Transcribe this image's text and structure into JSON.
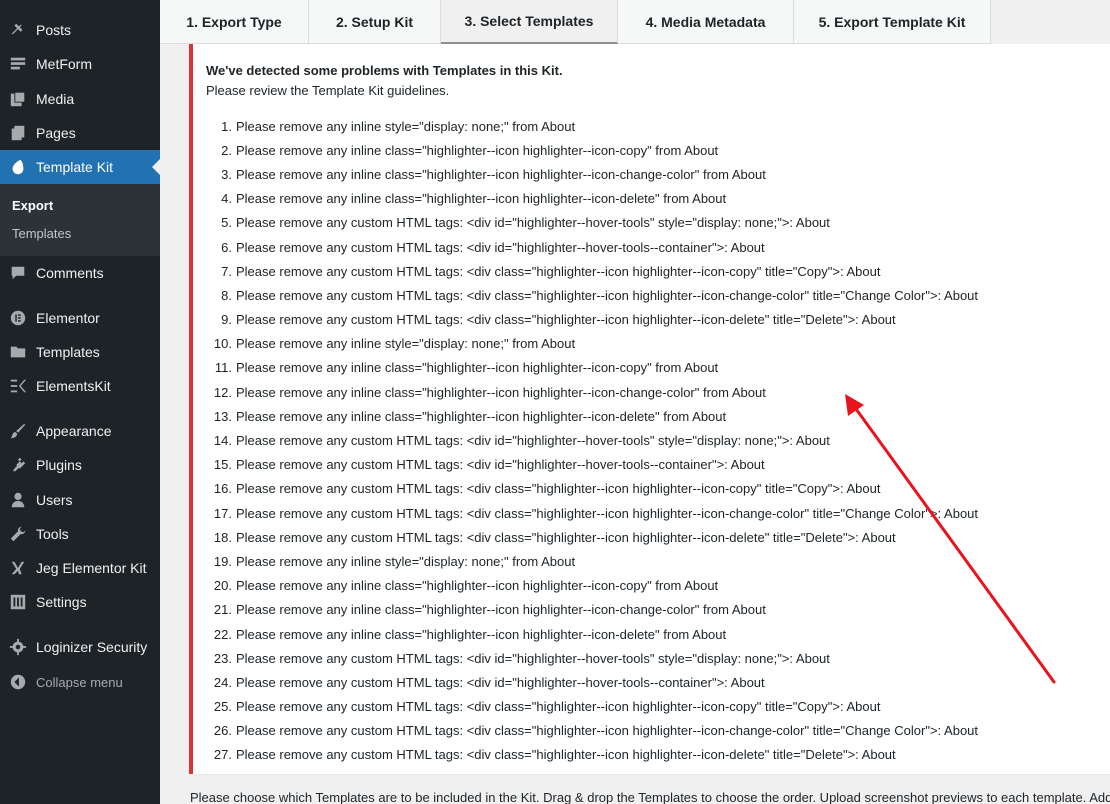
{
  "sidebar": {
    "items": [
      {
        "label": "Posts",
        "icon": "pushpin-icon"
      },
      {
        "label": "MetForm",
        "icon": "form-icon"
      },
      {
        "label": "Media",
        "icon": "media-icon"
      },
      {
        "label": "Pages",
        "icon": "pages-icon"
      },
      {
        "label": "Template Kit",
        "icon": "template-kit-icon",
        "active": true
      },
      {
        "label": "Comments",
        "icon": "comments-icon"
      },
      {
        "label": "Elementor",
        "icon": "elementor-icon"
      },
      {
        "label": "Templates",
        "icon": "folder-icon"
      },
      {
        "label": "ElementsKit",
        "icon": "elementskit-icon"
      },
      {
        "label": "Appearance",
        "icon": "paintbrush-icon"
      },
      {
        "label": "Plugins",
        "icon": "plugin-icon"
      },
      {
        "label": "Users",
        "icon": "users-icon"
      },
      {
        "label": "Tools",
        "icon": "wrench-icon"
      },
      {
        "label": "Jeg Elementor Kit",
        "icon": "jeg-kit-icon"
      },
      {
        "label": "Settings",
        "icon": "settings-icon"
      },
      {
        "label": "Loginizer Security",
        "icon": "gear-icon"
      }
    ],
    "submenu": {
      "export": "Export",
      "templates": "Templates"
    },
    "collapse_label": "Collapse menu"
  },
  "tabs": [
    {
      "label": "1. Export Type"
    },
    {
      "label": "2. Setup Kit"
    },
    {
      "label": "3. Select Templates",
      "active": true
    },
    {
      "label": "4. Media Metadata"
    },
    {
      "label": "5. Export Template Kit"
    }
  ],
  "notice": {
    "title": "We've detected some problems with Templates in this Kit.",
    "subtitle": "Please review the Template Kit guidelines.",
    "accent_color": "#d63638",
    "problems": [
      "Please remove any inline style=\"display: none;\" from About",
      "Please remove any inline class=\"highlighter--icon highlighter--icon-copy\" from About",
      "Please remove any inline class=\"highlighter--icon highlighter--icon-change-color\" from About",
      "Please remove any inline class=\"highlighter--icon highlighter--icon-delete\" from About",
      "Please remove any custom HTML tags: <div id=\"highlighter--hover-tools\" style=\"display: none;\">: About",
      "Please remove any custom HTML tags: <div id=\"highlighter--hover-tools--container\">: About",
      "Please remove any custom HTML tags: <div class=\"highlighter--icon highlighter--icon-copy\" title=\"Copy\">: About",
      "Please remove any custom HTML tags: <div class=\"highlighter--icon highlighter--icon-change-color\" title=\"Change Color\">: About",
      "Please remove any custom HTML tags: <div class=\"highlighter--icon highlighter--icon-delete\" title=\"Delete\">: About",
      "Please remove any inline style=\"display: none;\" from About",
      "Please remove any inline class=\"highlighter--icon highlighter--icon-copy\" from About",
      "Please remove any inline class=\"highlighter--icon highlighter--icon-change-color\" from About",
      "Please remove any inline class=\"highlighter--icon highlighter--icon-delete\" from About",
      "Please remove any custom HTML tags: <div id=\"highlighter--hover-tools\" style=\"display: none;\">: About",
      "Please remove any custom HTML tags: <div id=\"highlighter--hover-tools--container\">: About",
      "Please remove any custom HTML tags: <div class=\"highlighter--icon highlighter--icon-copy\" title=\"Copy\">: About",
      "Please remove any custom HTML tags: <div class=\"highlighter--icon highlighter--icon-change-color\" title=\"Change Color\">: About",
      "Please remove any custom HTML tags: <div class=\"highlighter--icon highlighter--icon-delete\" title=\"Delete\">: About",
      "Please remove any inline style=\"display: none;\" from About",
      "Please remove any inline class=\"highlighter--icon highlighter--icon-copy\" from About",
      "Please remove any inline class=\"highlighter--icon highlighter--icon-change-color\" from About",
      "Please remove any inline class=\"highlighter--icon highlighter--icon-delete\" from About",
      "Please remove any custom HTML tags: <div id=\"highlighter--hover-tools\" style=\"display: none;\">: About",
      "Please remove any custom HTML tags: <div id=\"highlighter--hover-tools--container\">: About",
      "Please remove any custom HTML tags: <div class=\"highlighter--icon highlighter--icon-copy\" title=\"Copy\">: About",
      "Please remove any custom HTML tags: <div class=\"highlighter--icon highlighter--icon-change-color\" title=\"Change Color\">: About",
      "Please remove any custom HTML tags: <div class=\"highlighter--icon highlighter--icon-delete\" title=\"Delete\">: About"
    ]
  },
  "footer_text": "Please choose which Templates are to be included in the Kit. Drag & drop the Templates to choose the order. Upload screenshot previews to each template. Add",
  "annotation": {
    "color": "#e8141b"
  }
}
